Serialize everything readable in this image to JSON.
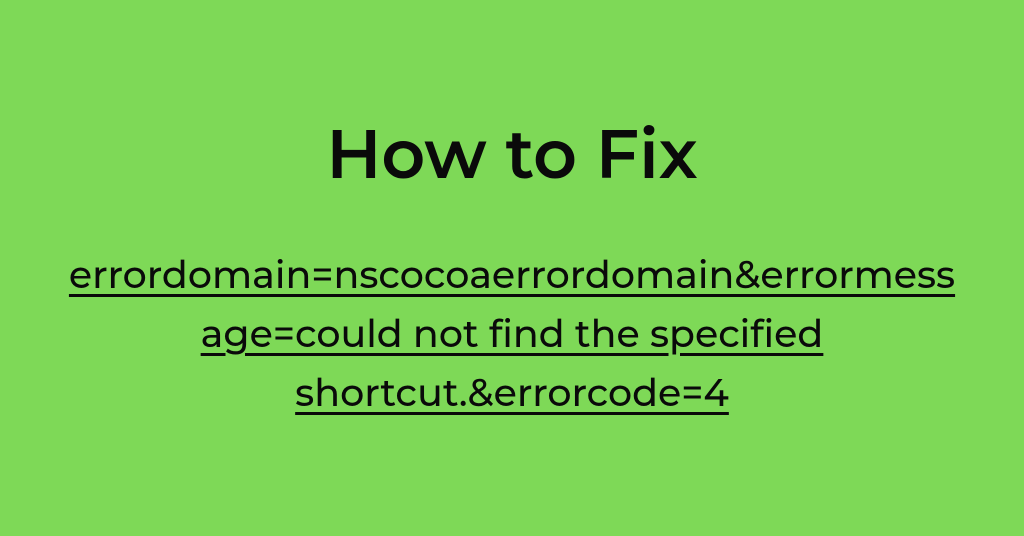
{
  "heading": "How to Fix",
  "subtext": "errordomain=nscocoaerrordomain&errormessage=could not find the specified shortcut.&errorcode=4",
  "colors": {
    "background": "#7ed957",
    "text": "#0a0a0a"
  }
}
